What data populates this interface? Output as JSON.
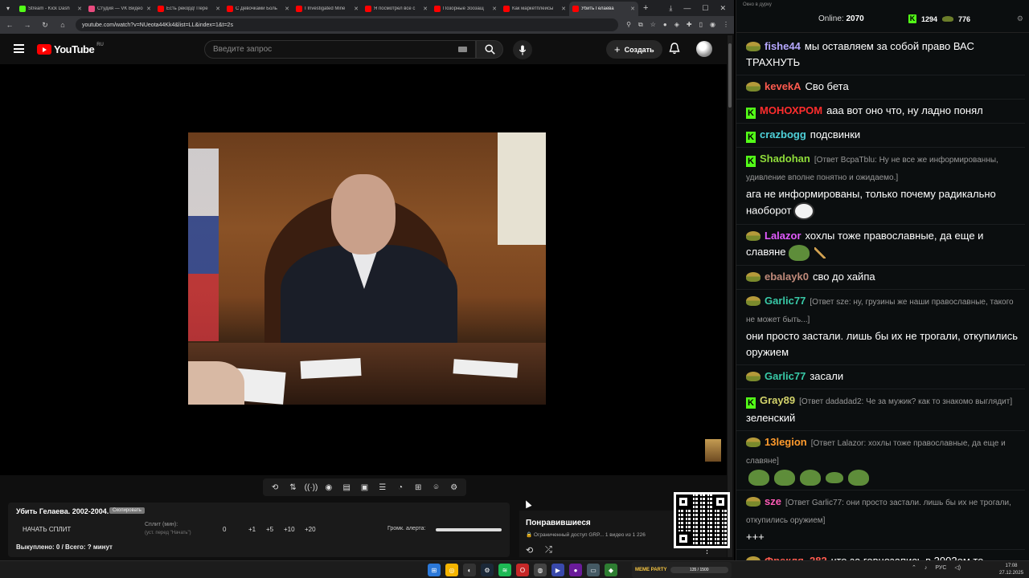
{
  "browser": {
    "tabs": [
      {
        "title": "Stream - Kick Dash",
        "color": "#53fc18",
        "active": false
      },
      {
        "title": "Студия — VK Видео",
        "color": "#e94b7f",
        "active": false
      },
      {
        "title": "Есть рекорд! Пере",
        "color": "#ff0000",
        "active": false
      },
      {
        "title": "С Девочками Боль",
        "color": "#ff0000",
        "active": false
      },
      {
        "title": "I Investigated Mine",
        "color": "#ff0000",
        "active": false
      },
      {
        "title": "Я посмотрел все с",
        "color": "#ff0000",
        "active": false
      },
      {
        "title": "Позорные Зоозащ",
        "color": "#ff0000",
        "active": false
      },
      {
        "title": "Как маркетплейсы",
        "color": "#ff0000",
        "active": false
      },
      {
        "title": "Убить Гелаева",
        "color": "#ff0000",
        "active": true
      }
    ],
    "url": "youtube.com/watch?v=NUeota44Kk4&list=LL&index=1&t=2s",
    "controls": {
      "minimize": "—",
      "maximize": "☐",
      "close": "✕"
    }
  },
  "youtube": {
    "logo_text": "YouTube",
    "region": "RU",
    "search_placeholder": "Введите запрос",
    "create_label": "Создать"
  },
  "extension_toolbar": {
    "icons": [
      "repeat-icon",
      "sort-icon",
      "broadcast-icon",
      "eye-icon",
      "film-icon",
      "pip-icon",
      "subtitles-icon",
      "speed-icon",
      "screenshot-icon",
      "camera-icon",
      "gear-icon"
    ]
  },
  "splits": {
    "title": "Убить Гелаева. 2002-2004.",
    "badge": "Скопировать",
    "start_label": "НАЧАТЬ СПЛИТ",
    "split_label": "Сплит (мин):",
    "split_sub": "(уст. перед \"Начать\")",
    "values": [
      "0",
      "+1",
      "+5",
      "+10",
      "+20"
    ],
    "alert_label": "Громк. алерта:",
    "stats": "Выкуплено: 0 / Всего: ? минут"
  },
  "playlist": {
    "title": "Понравившиеся",
    "meta": "🔒 Ограниченный доступ GRP...   1 видео из 1 226"
  },
  "chat": {
    "window_title": "Окно в дурку",
    "online_label": "Online:",
    "online_count": "2070",
    "kick_count": "1294",
    "other_count": "776",
    "messages": [
      {
        "badge": "pepe",
        "user": "fishe44",
        "color": "#b6a8ff",
        "reply": "",
        "text": "мы оставляем за собой право ВАС ТРАХНУТЬ",
        "emotes": []
      },
      {
        "badge": "pepe",
        "user": "kevekA",
        "color": "#ff5b4f",
        "reply": "",
        "text": "Сво бета",
        "emotes": []
      },
      {
        "badge": "kick",
        "user": "МОНОХРОМ",
        "color": "#ff2d2d",
        "reply": "",
        "text": "ааа вот оно что, ну ладно понял",
        "emotes": []
      },
      {
        "badge": "kick",
        "user": "crazbogg",
        "color": "#4fd1d9",
        "reply": "",
        "text": "подсвинки",
        "emotes": []
      },
      {
        "badge": "kick",
        "user": "Shadohan",
        "color": "#8fdc3a",
        "reply": "[Ответ ВсраТblu: Ну не все же информированны, удивление вполне понятно и ожидаемо.]",
        "text": "ага не информированы, только почему радикально наоборот",
        "emotes": [
          "face"
        ]
      },
      {
        "badge": "pepe",
        "user": "Lalazor",
        "color": "#e35bff",
        "reply": "",
        "text": "хохлы тоже православные, да еще и славяне",
        "emotes": [
          "frog",
          "stick"
        ]
      },
      {
        "badge": "pepe",
        "user": "ebalayk0",
        "color": "#c08a7a",
        "reply": "",
        "text": "сво до хайпа",
        "emotes": []
      },
      {
        "badge": "pepe",
        "user": "Garlic77",
        "color": "#38c9a7",
        "reply": "[Ответ sze: ну, грузины же наши православные, такого не может быть...]",
        "text": "они просто застали. лишь бы их не трогали, откупились оружием",
        "emotes": []
      },
      {
        "badge": "pepe",
        "user": "Garlic77",
        "color": "#38c9a7",
        "reply": "",
        "text": "засали",
        "emotes": []
      },
      {
        "badge": "kick",
        "user": "Gray89",
        "color": "#d3d36b",
        "reply": "[Ответ dadadad2: Че за мужик? как то знакомо выглядит]",
        "text": "зеленский",
        "emotes": []
      },
      {
        "badge": "pepe",
        "user": "13legion",
        "color": "#ff9b2d",
        "reply": "[Ответ Lalazor: хохлы тоже православные, да еще и славяне]",
        "text": "",
        "emotes": [
          "frog",
          "frog",
          "frog",
          "frog-sm",
          "frog"
        ]
      },
      {
        "badge": "pepe",
        "user": "sze",
        "color": "#ff5bb7",
        "reply": "[Ответ Garlic77: они просто застали. лишь бы их не трогали, откупились оружием]",
        "text": "+++",
        "emotes": []
      },
      {
        "badge": "pepe",
        "user": "Фрекля_282",
        "color": "#ff5b4f",
        "reply": "",
        "text": "что за говнозапись в 2002ом то",
        "emotes": []
      }
    ]
  },
  "taskbar": {
    "widget_label": "MEME PARTY",
    "widget_value": "135 / 1500",
    "lang": "РУС",
    "time": "17:08",
    "date": "27.12.2025"
  }
}
